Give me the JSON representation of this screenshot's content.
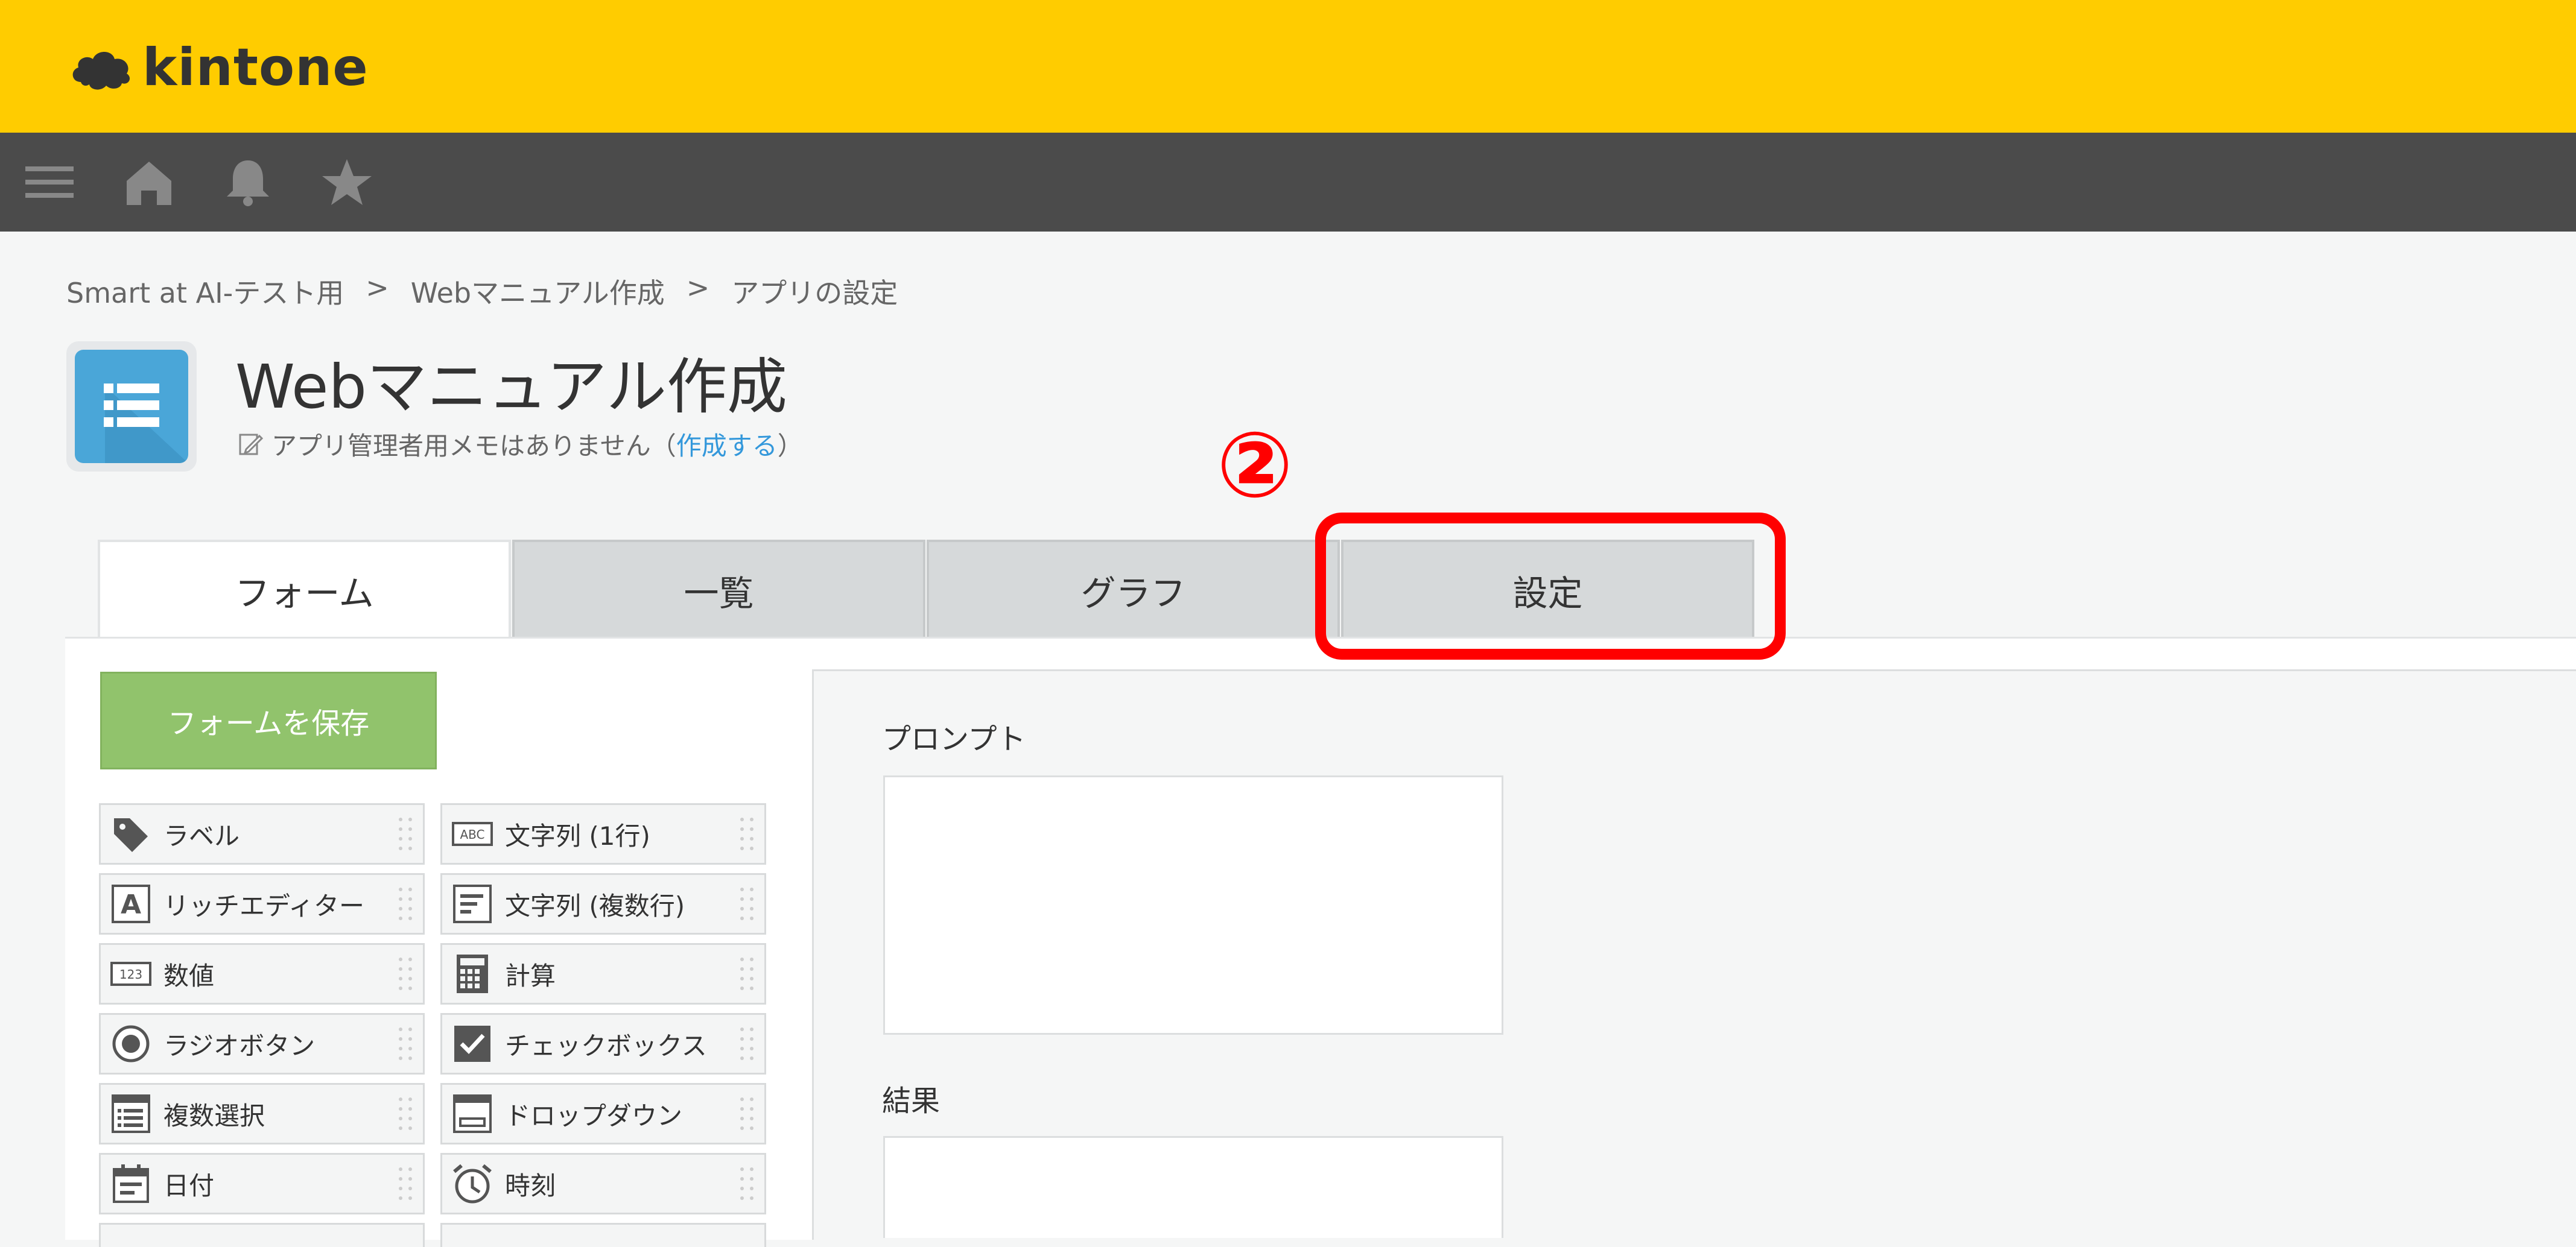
{
  "header": {
    "logo_text": "kintone",
    "brand_color": "#ffcc00"
  },
  "nav": {
    "icons": [
      "menu-icon",
      "home-icon",
      "bell-icon",
      "star-icon"
    ]
  },
  "breadcrumb": {
    "items": [
      "Smart at AI-テスト用",
      "Webマニュアル作成",
      "アプリの設定"
    ],
    "separator": ">"
  },
  "app": {
    "title": "Webマニュアル作成",
    "memo_text": "アプリ管理者用メモはありません（",
    "memo_link": "作成する",
    "memo_close": "）"
  },
  "annotation": {
    "number": "②",
    "color": "#ff0000"
  },
  "tabs": [
    {
      "label": "フォーム",
      "active": true
    },
    {
      "label": "一覧",
      "active": false
    },
    {
      "label": "グラフ",
      "active": false
    },
    {
      "label": "設定",
      "active": false
    }
  ],
  "save_button": "フォームを保存",
  "palette": [
    {
      "label": "ラベル",
      "icon": "tag-icon"
    },
    {
      "label": "文字列 (1行)",
      "icon": "abc-icon"
    },
    {
      "label": "リッチエディター",
      "icon": "rich-editor-icon"
    },
    {
      "label": "文字列 (複数行)",
      "icon": "multiline-icon"
    },
    {
      "label": "数値",
      "icon": "number-icon"
    },
    {
      "label": "計算",
      "icon": "calculator-icon"
    },
    {
      "label": "ラジオボタン",
      "icon": "radio-icon"
    },
    {
      "label": "チェックボックス",
      "icon": "checkbox-icon"
    },
    {
      "label": "複数選択",
      "icon": "multi-select-icon"
    },
    {
      "label": "ドロップダウン",
      "icon": "dropdown-icon"
    },
    {
      "label": "日付",
      "icon": "calendar-icon"
    },
    {
      "label": "時刻",
      "icon": "clock-icon"
    }
  ],
  "form": {
    "fields": [
      {
        "label": "プロンプト"
      },
      {
        "label": "結果"
      }
    ]
  }
}
